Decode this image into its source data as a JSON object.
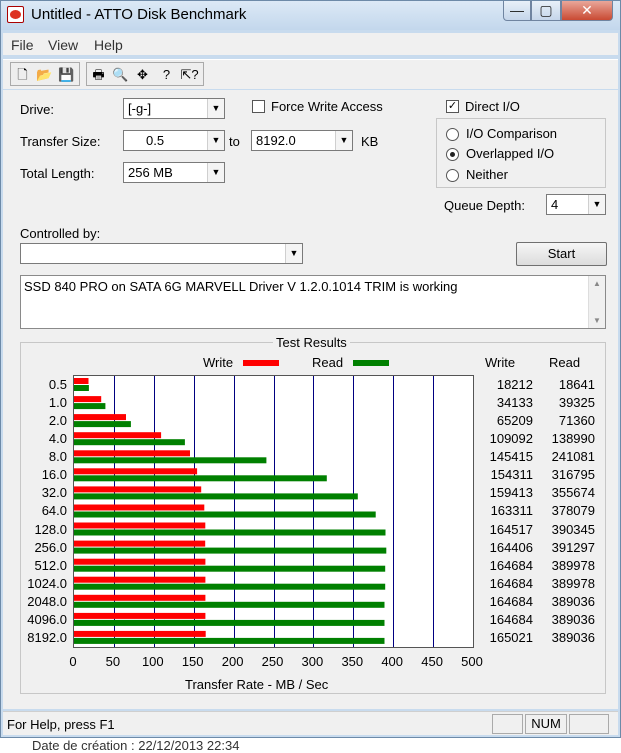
{
  "window": {
    "title": "Untitled - ATTO Disk Benchmark"
  },
  "menu": [
    "File",
    "View",
    "Help"
  ],
  "form": {
    "drive_label": "Drive:",
    "drive_value": "[-g-]",
    "transfer_size_label": "Transfer Size:",
    "transfer_from": "0.5",
    "transfer_to_label": "to",
    "transfer_to": "8192.0",
    "transfer_unit": "KB",
    "total_length_label": "Total Length:",
    "total_length_value": "256 MB",
    "force_write_label": "Force Write Access",
    "force_write_checked": false,
    "direct_io_label": "Direct I/O",
    "direct_io_checked": true,
    "io_options": [
      {
        "label": "I/O Comparison",
        "selected": false
      },
      {
        "label": "Overlapped I/O",
        "selected": true
      },
      {
        "label": "Neither",
        "selected": false
      }
    ],
    "queue_depth_label": "Queue Depth:",
    "queue_depth_value": "4",
    "controlled_by_label": "Controlled by:",
    "controlled_by_value": "",
    "start_label": "Start",
    "description": "SSD 840 PRO on SATA 6G MARVELL Driver V 1.2.0.1014 TRIM is working"
  },
  "results": {
    "title": "Test Results",
    "write_legend": "Write",
    "read_legend": "Read",
    "write_col_header": "Write",
    "read_col_header": "Read"
  },
  "chart_data": {
    "type": "bar",
    "orientation": "horizontal",
    "xlabel": "Transfer Rate - MB / Sec",
    "xlim": [
      0,
      500
    ],
    "xticks": [
      "0",
      "50",
      "100",
      "150",
      "200",
      "250",
      "300",
      "350",
      "400",
      "450",
      "500"
    ],
    "categories": [
      "0.5",
      "1.0",
      "2.0",
      "4.0",
      "8.0",
      "16.0",
      "32.0",
      "64.0",
      "128.0",
      "256.0",
      "512.0",
      "1024.0",
      "2048.0",
      "4096.0",
      "8192.0"
    ],
    "series": [
      {
        "name": "Write",
        "color": "#ff0000",
        "values": [
          18.212,
          34.133,
          65.209,
          109.092,
          145.415,
          154.311,
          159.413,
          163.311,
          164.517,
          164.406,
          164.684,
          164.684,
          164.684,
          164.684,
          165.021
        ]
      },
      {
        "name": "Read",
        "color": "#008000",
        "values": [
          18.641,
          39.325,
          71.36,
          138.99,
          241.081,
          316.795,
          355.674,
          378.079,
          390.345,
          391.297,
          389.978,
          389.978,
          389.036,
          389.036,
          389.036
        ]
      }
    ],
    "write_values_text": [
      "18212",
      "34133",
      "65209",
      "109092",
      "145415",
      "154311",
      "159413",
      "163311",
      "164517",
      "164406",
      "164684",
      "164684",
      "164684",
      "164684",
      "165021"
    ],
    "read_values_text": [
      "18641",
      "39325",
      "71360",
      "138990",
      "241081",
      "316795",
      "355674",
      "378079",
      "390345",
      "391297",
      "389978",
      "389978",
      "389036",
      "389036",
      "389036"
    ]
  },
  "status": {
    "help_text": "For Help, press F1",
    "num": "NUM"
  },
  "behind_text": "Date de création : 22/12/2013 22:34"
}
